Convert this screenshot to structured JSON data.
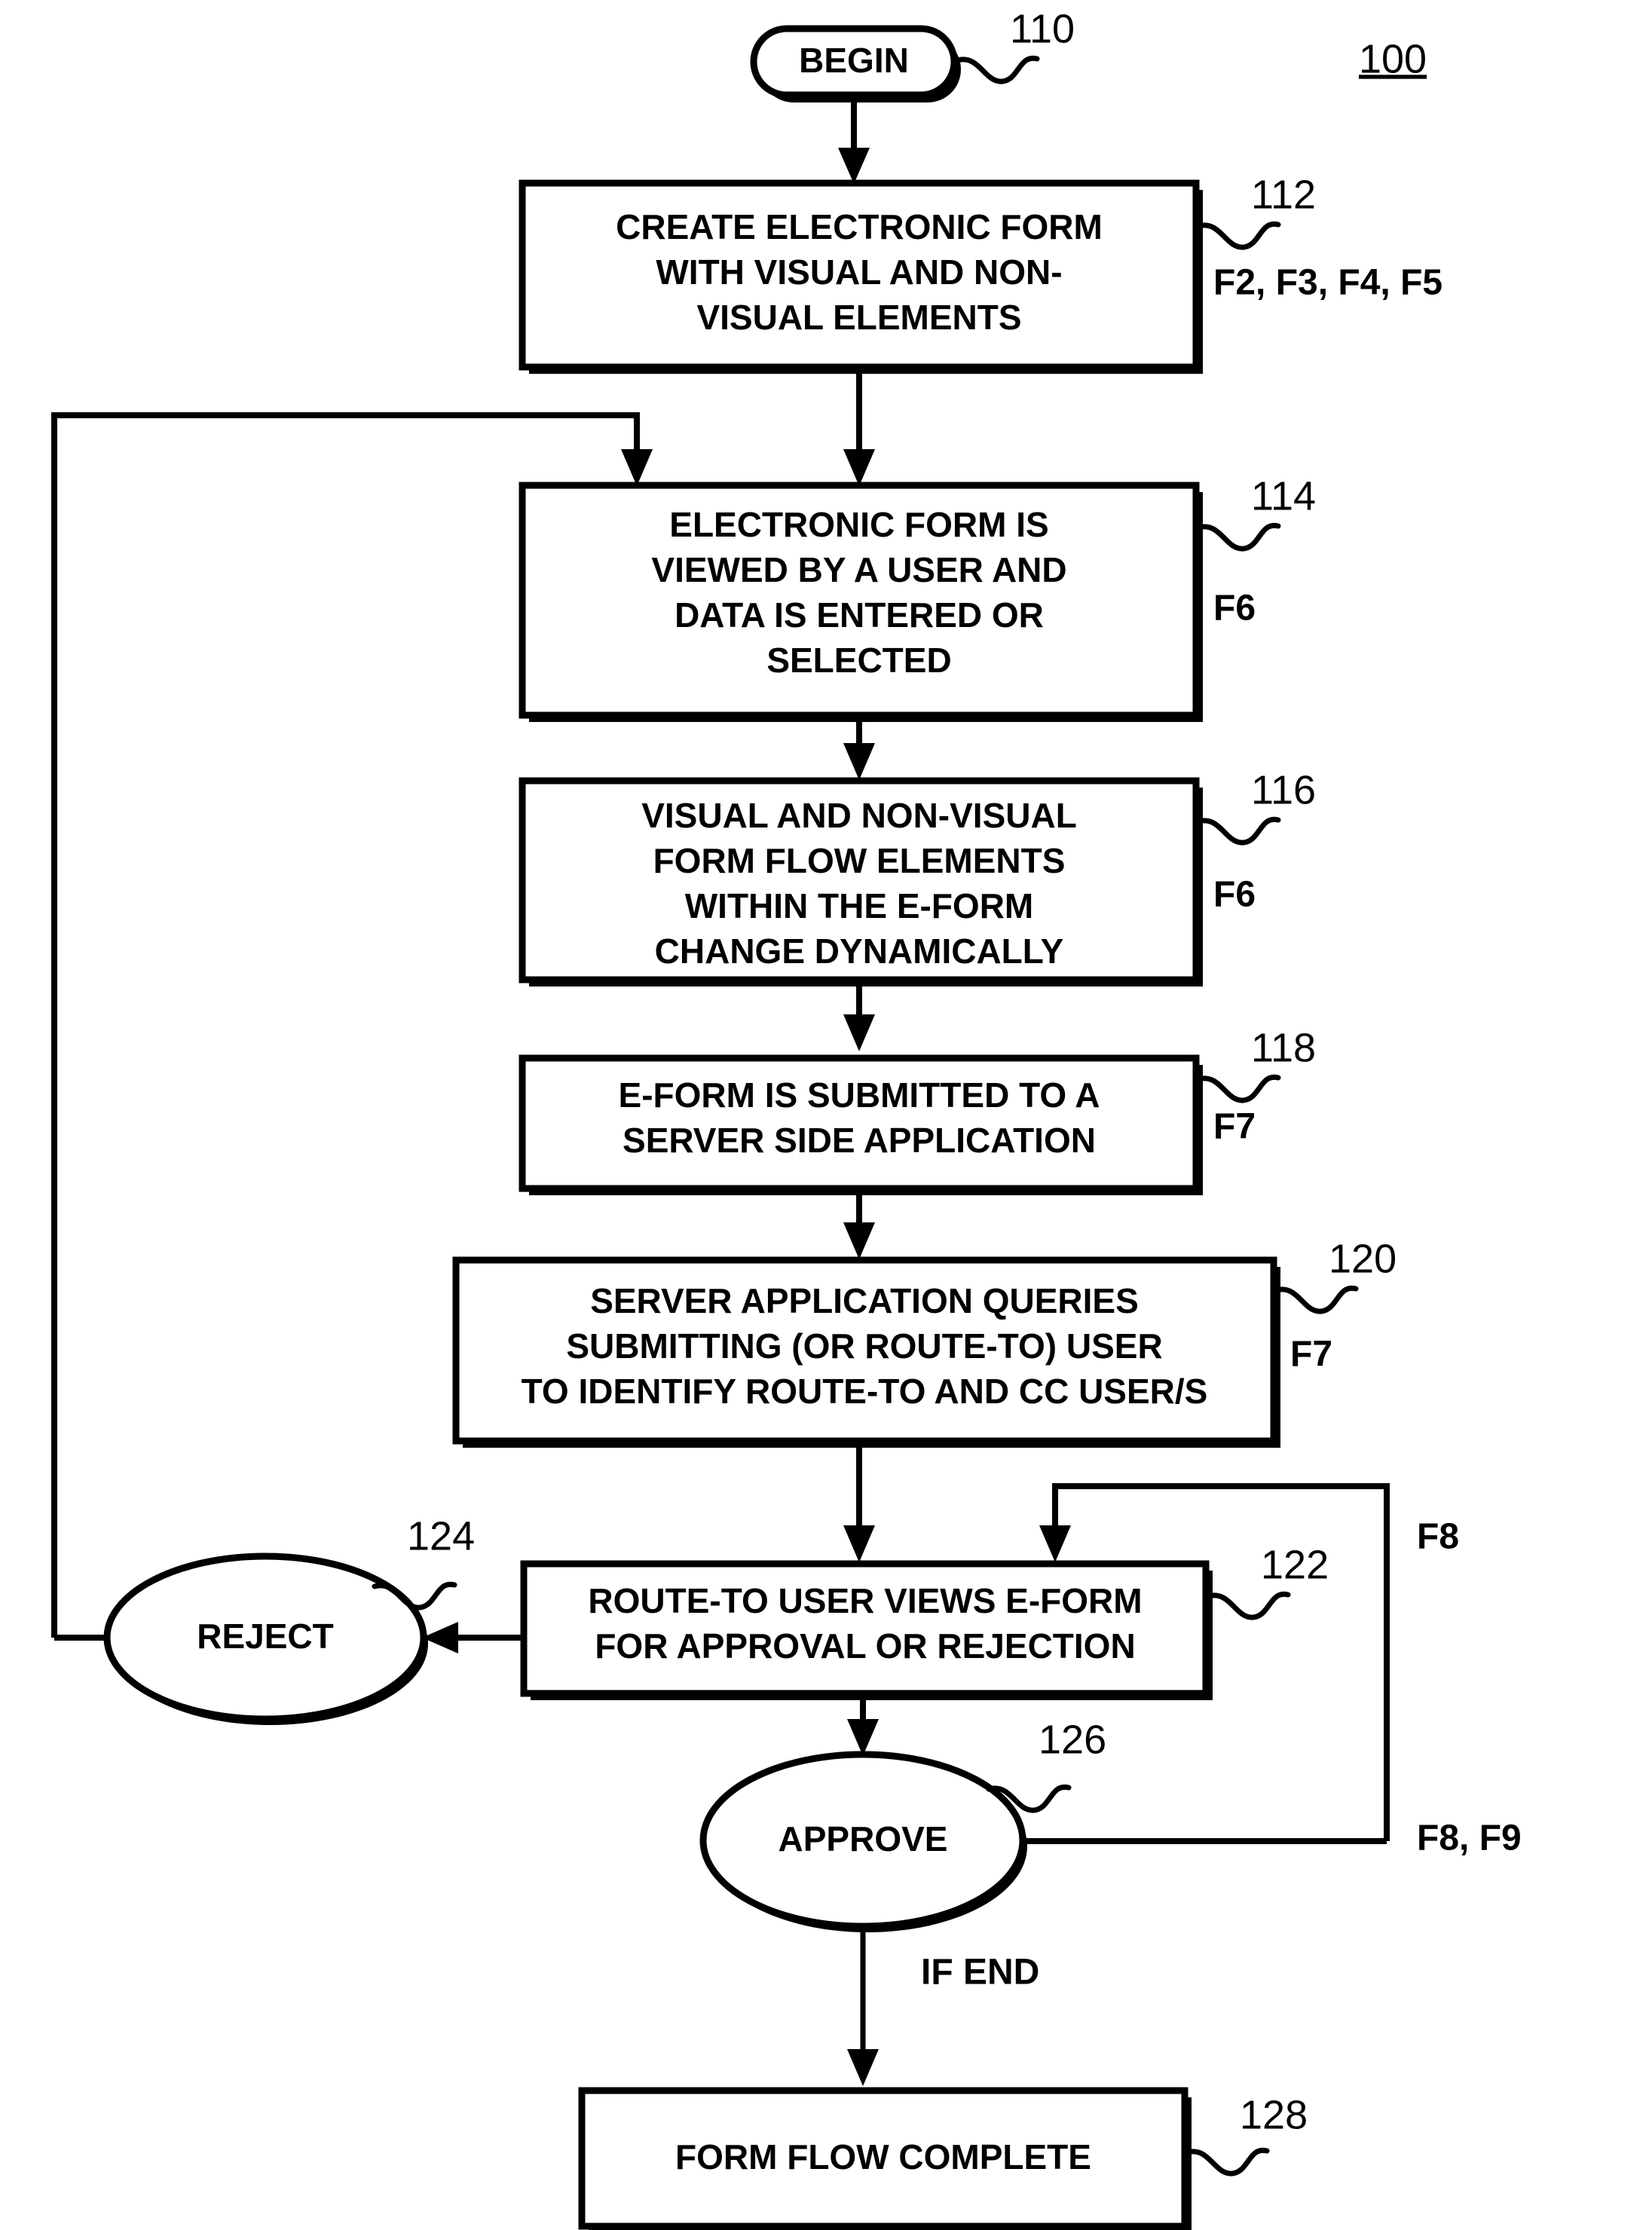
{
  "figure": {
    "number": "100"
  },
  "nodes": {
    "begin": {
      "label": "BEGIN",
      "ref": "110",
      "shape": "stadium"
    },
    "create_form": {
      "lines": [
        "CREATE ELECTRONIC FORM",
        "WITH VISUAL AND NON-",
        "VISUAL ELEMENTS"
      ],
      "ref": "112",
      "side_label": "F2, F3, F4, F5",
      "shape": "process"
    },
    "view_form": {
      "lines": [
        "ELECTRONIC FORM IS",
        "VIEWED BY A USER AND",
        "DATA IS ENTERED OR",
        "SELECTED"
      ],
      "ref": "114",
      "side_label": "F6",
      "shape": "process"
    },
    "dynamic_change": {
      "lines": [
        "VISUAL AND NON-VISUAL",
        "FORM FLOW ELEMENTS",
        "WITHIN THE E-FORM",
        "CHANGE DYNAMICALLY"
      ],
      "ref": "116",
      "side_label": "F6",
      "shape": "process"
    },
    "submit": {
      "lines": [
        "E-FORM IS SUBMITTED TO A",
        "SERVER SIDE APPLICATION"
      ],
      "ref": "118",
      "side_label": "F7",
      "shape": "process"
    },
    "server_query": {
      "lines": [
        "SERVER APPLICATION QUERIES",
        "SUBMITTING (OR ROUTE-TO) USER",
        "TO IDENTIFY ROUTE-TO AND CC USER/S"
      ],
      "ref": "120",
      "side_label": "F7",
      "shape": "process"
    },
    "route_to_review": {
      "lines": [
        "ROUTE-TO USER VIEWS E-FORM",
        "FOR APPROVAL OR REJECTION"
      ],
      "ref": "122",
      "side_label": "",
      "shape": "process"
    },
    "reject": {
      "label": "REJECT",
      "ref": "124",
      "shape": "ellipse"
    },
    "approve": {
      "label": "APPROVE",
      "ref": "126",
      "shape": "ellipse"
    },
    "complete": {
      "lines": [
        "FORM FLOW COMPLETE"
      ],
      "ref": "128",
      "side_label": "",
      "shape": "process"
    }
  },
  "edge_labels": {
    "approve_loop_upper": "F8",
    "approve_loop_lower": "F8, F9",
    "if_end": "IF END"
  },
  "colors": {
    "stroke": "#000000",
    "fill": "#ffffff"
  }
}
